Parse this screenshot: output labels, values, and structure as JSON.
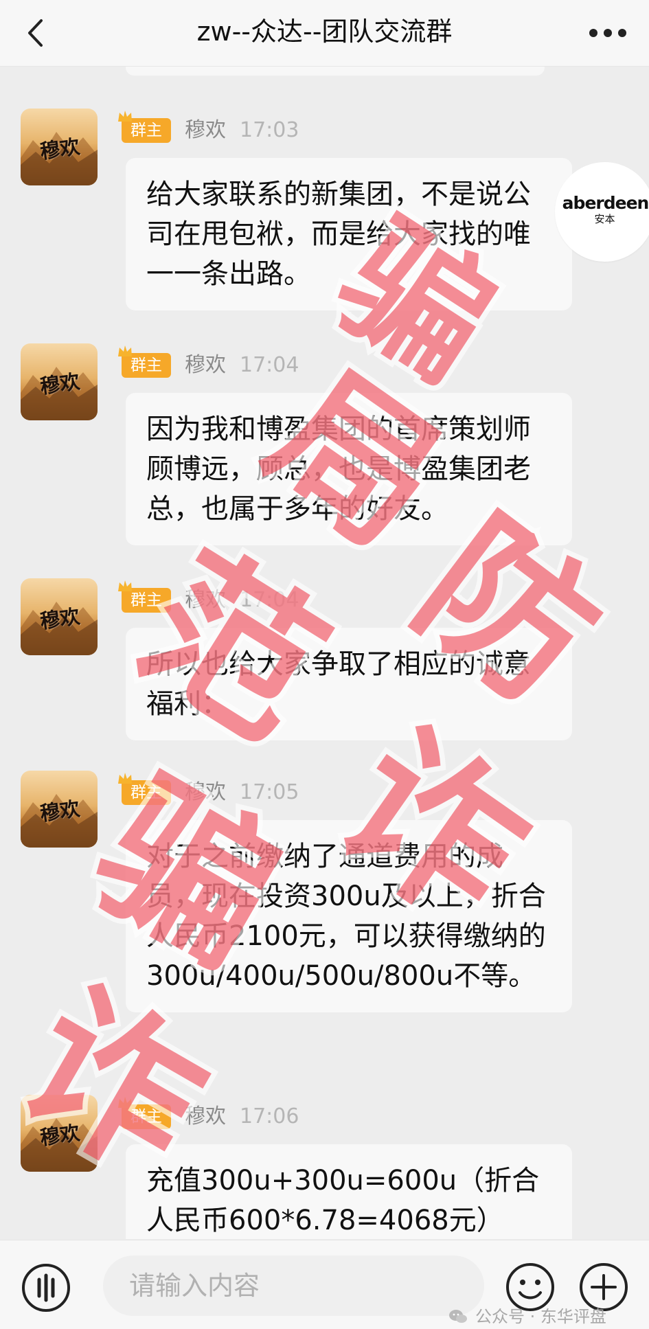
{
  "header": {
    "title": "zw--众达--团队交流群"
  },
  "messages": [
    {
      "role": "群主",
      "sender": "穆欢",
      "time": "17:03",
      "avatar_text": "穆欢",
      "text": "给大家联系的新集团，不是说公司在甩包袱，而是给大家找的唯一一条出路。"
    },
    {
      "role": "群主",
      "sender": "穆欢",
      "time": "17:04",
      "avatar_text": "穆欢",
      "text": "因为我和博盈集团的首席策划师顾博远，顾总，也是博盈集团老总，也属于多年的好友。"
    },
    {
      "role": "群主",
      "sender": "穆欢",
      "time": "17:04",
      "avatar_text": "穆欢",
      "text": "所以也给大家争取了相应的诚意福利："
    },
    {
      "role": "群主",
      "sender": "穆欢",
      "time": "17:05",
      "avatar_text": "穆欢",
      "text": "对于之前缴纳了通道费用的成员，现在投资300u及以上，折合人民币2100元，可以获得缴纳的300u/400u/500u/800u不等。"
    },
    {
      "role": "群主",
      "sender": "穆欢",
      "time": "17:06",
      "avatar_text": "穆欢",
      "text": "充值300u+300u=600u（折合人民币600*6.78=4068元）"
    }
  ],
  "brand_watermark": {
    "name": "aberdeen",
    "subtitle": "安本"
  },
  "stamp_words": [
    "骗",
    "局",
    "防",
    "范",
    "诈",
    "骗",
    "诈"
  ],
  "input": {
    "placeholder": "请输入内容",
    "value": ""
  },
  "channel_watermark": {
    "text": "公众号 · 东华评盘"
  },
  "icons": {
    "back": "chevron-left-icon",
    "more": "more-dots-icon",
    "voice": "voice-icon",
    "emoji": "emoji-icon",
    "add": "plus-circle-icon",
    "crown": "crown-icon",
    "wechat": "wechat-icon"
  },
  "colors": {
    "background": "#ededed",
    "bubble": "#f8f8f8",
    "role_badge": "#f6a829",
    "stamp": "#ec303f"
  }
}
